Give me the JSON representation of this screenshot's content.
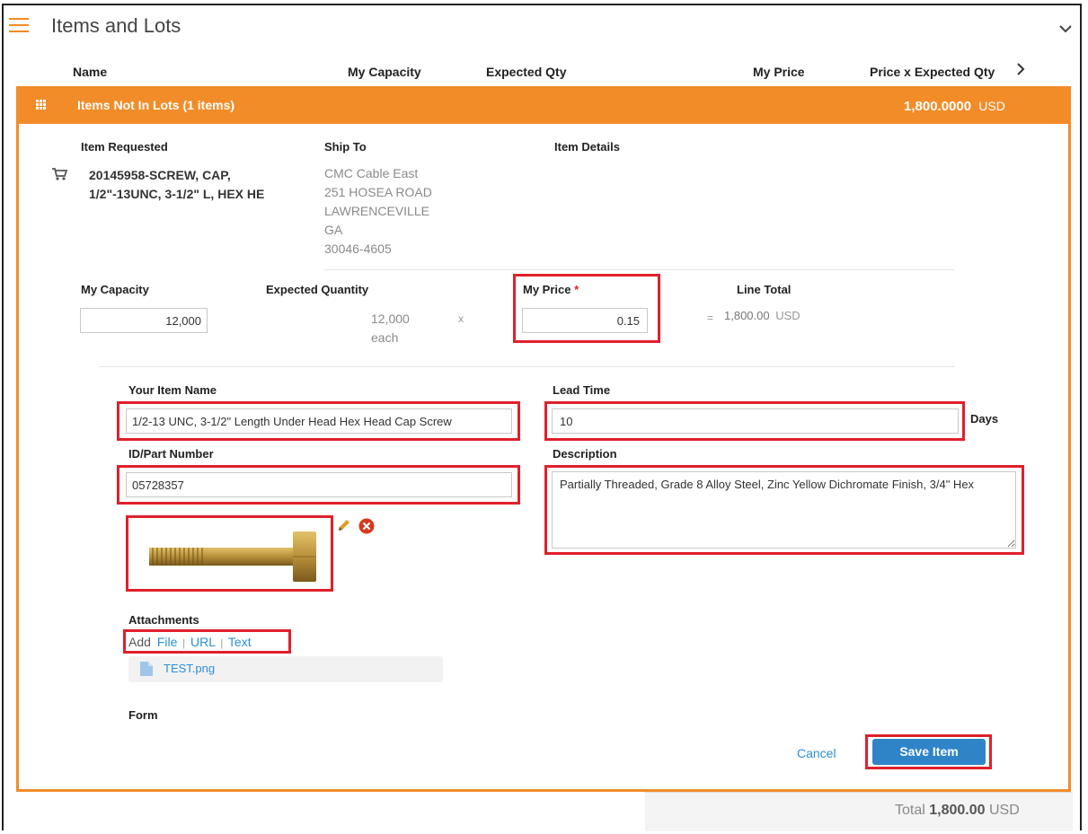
{
  "header": {
    "title": "Items and Lots"
  },
  "columns": {
    "name": "Name",
    "capacity": "My Capacity",
    "expected": "Expected Qty",
    "price": "My Price",
    "price_expected": "Price x Expected Qty"
  },
  "group": {
    "label": "Items Not In Lots (1 items)",
    "total": "1,800.0000",
    "currency": "USD"
  },
  "item": {
    "requested_label": "Item Requested",
    "ship_label": "Ship To",
    "details_label": "Item Details",
    "name_line1": "20145958-SCREW, CAP,",
    "name_line2": "1/2\"-13UNC, 3-1/2\" L, HEX HE",
    "ship_lines": [
      "CMC Cable East",
      "251 HOSEA ROAD",
      "LAWRENCEVILLE",
      "GA",
      "30046-4605"
    ]
  },
  "qty": {
    "capacity_label": "My Capacity",
    "capacity_value": "12,000",
    "expected_label": "Expected Quantity",
    "expected_value": "12,000",
    "expected_unit": "each",
    "times": "x",
    "price_label": "My Price",
    "required": "*",
    "price_value": "0.15",
    "equals": "=",
    "line_total_label": "Line Total",
    "line_total": "1,800.00",
    "line_currency": "USD"
  },
  "form": {
    "item_name_label": "Your Item Name",
    "item_name_value": "1/2-13 UNC, 3-1/2\" Length Under Head Hex Head Cap Screw",
    "lead_label": "Lead Time",
    "lead_value": "10",
    "days": "Days",
    "part_label": "ID/Part Number",
    "part_value": "05728357",
    "desc_label": "Description",
    "desc_value": "Partially Threaded, Grade 8 Alloy Steel, Zinc Yellow Dichromate Finish, 3/4\" Hex",
    "attach_label": "Attachments",
    "add": "Add",
    "file": "File",
    "url": "URL",
    "text": "Text",
    "sep": "|",
    "attachment_name": "TEST.png",
    "form_label": "Form"
  },
  "actions": {
    "cancel": "Cancel",
    "save": "Save Item"
  },
  "footer": {
    "total_label": "Total",
    "total_value": "1,800.00",
    "currency": "USD"
  },
  "colors": {
    "accent": "#f28c28",
    "highlight": "#e0202b",
    "link": "#2b8fd6",
    "button": "#2f84c8"
  }
}
